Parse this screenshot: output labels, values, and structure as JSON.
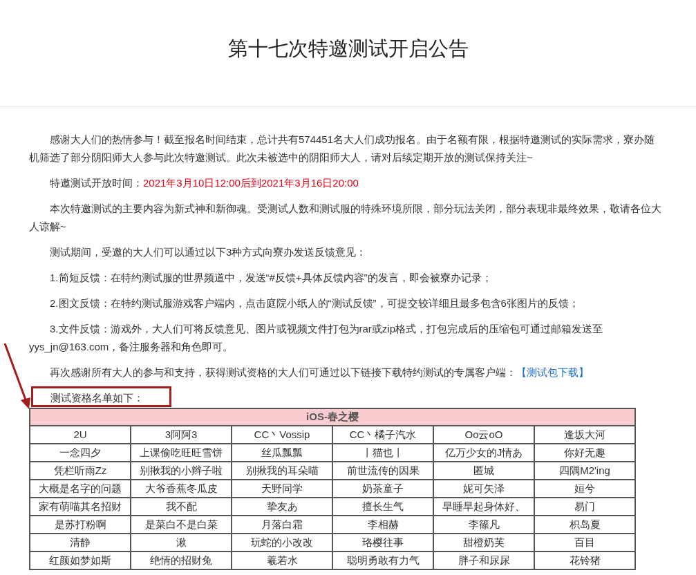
{
  "title": "第十七次特邀测试开启公告",
  "paragraphs": [
    {
      "kind": "text",
      "text": "感谢大人们的热情参与！截至报名时间结束，总计共有574451名大人们成功报名。由于名额有限，根据特邀测试的实际需求，寮办随机筛选了部分阴阳师大人参与此次特邀测试。此次未被选中的阴阳师大人，请对后续定期开放的测试保持关注~"
    },
    {
      "kind": "highlight",
      "text": "特邀测试开放时间：",
      "highlight": "2021年3月10日12:00后到2021年3月16日20:00"
    },
    {
      "kind": "text",
      "text": "本次特邀测试的主要内容为新式神和新御魂。受测试人数和测试服的特殊环境所限，部分玩法关闭，部分表现非最终效果，敬请各位大人谅解~"
    },
    {
      "kind": "text",
      "text": "测试期间，受邀的大人们可以通过以下3种方式向寮办发送反馈意见："
    },
    {
      "kind": "text",
      "text": "1.简短反馈：在特约测试服的世界频道中，发送“#反馈+具体反馈内容”的发言，即会被寮办记录；"
    },
    {
      "kind": "text",
      "text": "2.图文反馈：在特约测试服游戏客户端内，点击庭院小纸人的“测试反馈”，可提交较详细且最多包含6张图片的反馈；"
    },
    {
      "kind": "text",
      "text": "3.文件反馈：游戏外，大人们可将反馈意见、图片或视频文件打包为rar或zip格式，打包完成后的压缩包可通过邮箱发送至yys_jn@163.com，备注服务器和角色即可。"
    },
    {
      "kind": "link",
      "text": "再次感谢所有大人的参与和支持，获得测试资格的大人们可通过以下链接下载特约测试的专属客户端：",
      "link": "【测试包下载】"
    },
    {
      "kind": "boxed",
      "text": "测试资格名单如下："
    }
  ],
  "table": {
    "caption": "iOS-春之樱",
    "rows": [
      [
        "2U",
        "3阿阿3",
        "CC丶Vossip",
        "CC丶橘子汽水",
        "Oo云oO",
        "逢坂大河"
      ],
      [
        "一念四夕",
        "上课偷吃旺旺雪饼",
        "丝瓜瓢瓢",
        "丨猫也丨",
        "亿万少女的J情あ",
        "你好无趣"
      ],
      [
        "凭栏听雨Zz",
        "别揪我的小辫子啦",
        "别揪我的耳朵喵",
        "前世流传的因果",
        "匿城",
        "四隅M2'ing"
      ],
      [
        "大概是名字的问题",
        "大爷香蕉冬瓜皮",
        "天野同学",
        "奶茶童子",
        "妮可矢泽",
        "姮兮"
      ],
      [
        "家有萌喵其名招财",
        "我不配",
        "挚友あ",
        "擅长生气",
        "早睡早起身体好、",
        "易门"
      ],
      [
        "是苏打粉啊",
        "是菜白不是白菜",
        "月落白霜",
        "李相赫",
        "李篠凡",
        "枳岛夏"
      ],
      [
        "清静",
        "湫",
        "玩蛇的小改改",
        "珞樱往事",
        "甜橙奶芙",
        "百目"
      ],
      [
        "红颜如梦如斯",
        "绝情的招财兔",
        "羲若水",
        "聪明勇敢有力气",
        "胖子和尿尿",
        "花铃猪"
      ]
    ]
  }
}
